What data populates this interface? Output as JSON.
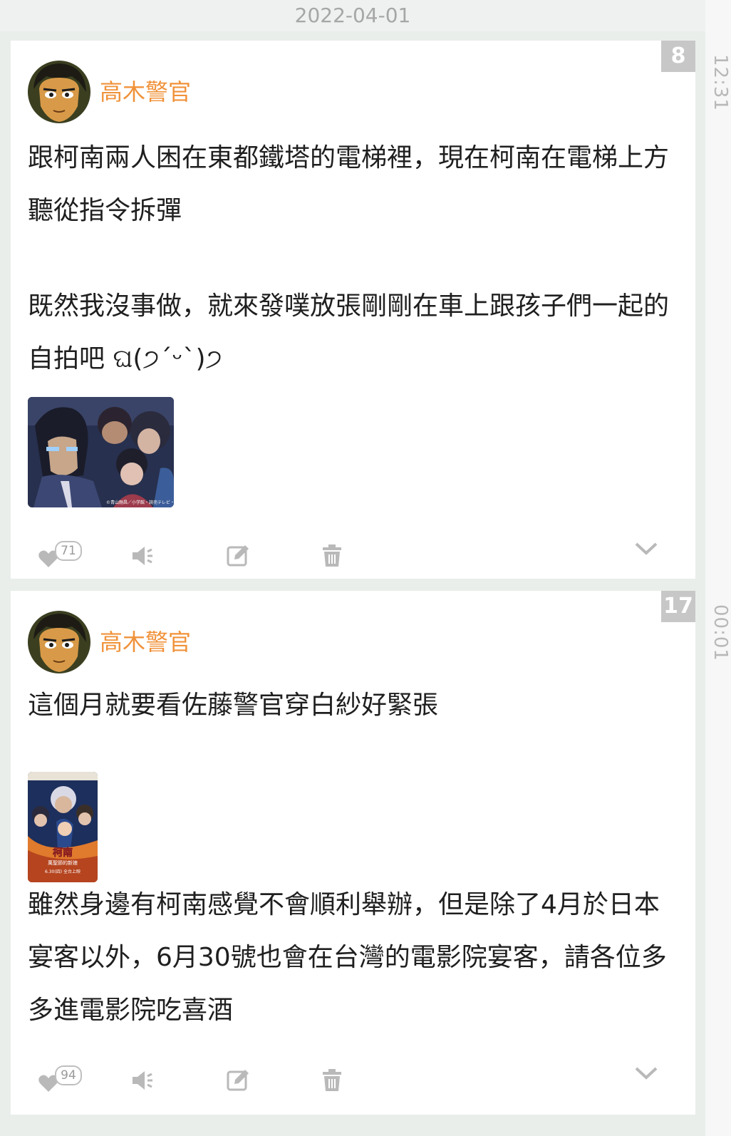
{
  "date_header": "2022-04-01",
  "posts": [
    {
      "time": "12:31",
      "count": "8",
      "author": "高木警官",
      "paragraphs": [
        "跟柯南兩人困在東都鐵塔的電梯裡，現在柯南在電梯上方聽從指令拆彈",
        "既然我沒事做，就來發噗放張剛剛在車上跟孩子們一起的自拍吧 ଘ(੭ˊᵕˋ)੭"
      ],
      "image_caption": "©青山剛昌／小学館・読売テレビ・TMS 1996",
      "likes": "71"
    },
    {
      "time": "00:01",
      "count": "17",
      "author": "高木警官",
      "paragraphs": [
        "這個月就要看佐藤警官穿白紗好緊張",
        "雖然身邊有柯南感覺不會順利舉辦，但是除了4月於日本宴客以外，6月30號也會在台灣的電影院宴客，請各位多多進電影院吃喜酒"
      ],
      "poster": {
        "title": "柯南",
        "subtitle": "萬聖節的新娘",
        "release": "6.30(四) 全台上映"
      },
      "likes": "94"
    }
  ],
  "icons": {
    "like": "heart-icon",
    "replurk": "megaphone-icon",
    "edit": "edit-icon",
    "delete": "trash-icon",
    "expand": "chevron-down-icon"
  },
  "colors": {
    "author": "#f0923a",
    "badge": "#c7c7c7",
    "background": "#e9eeea"
  }
}
